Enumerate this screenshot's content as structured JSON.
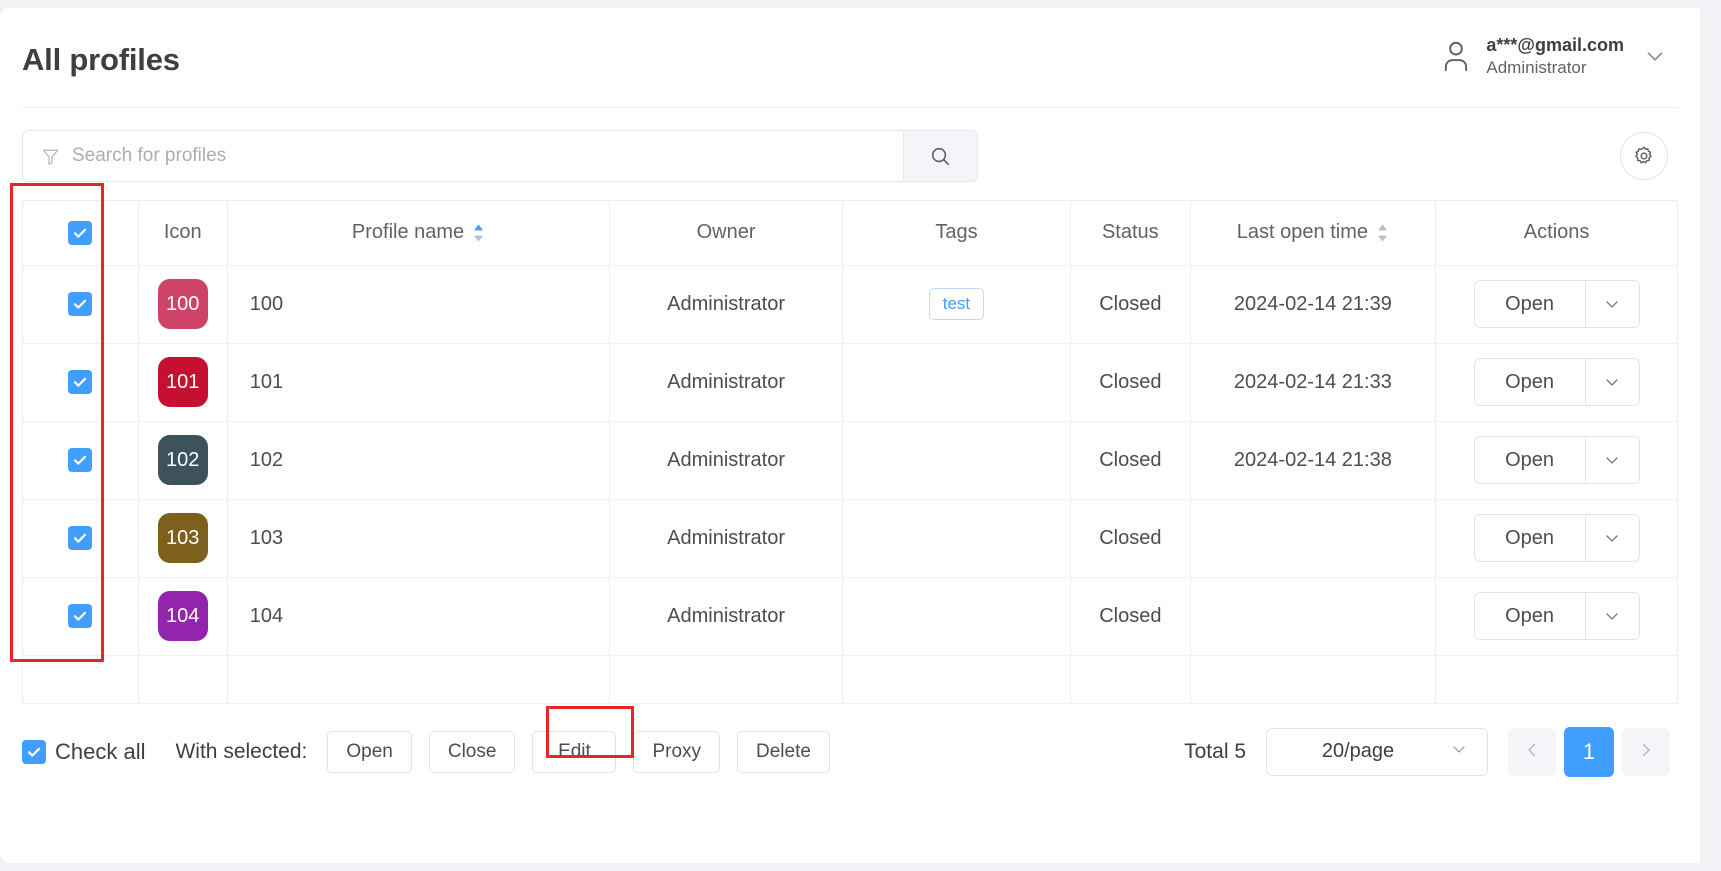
{
  "header": {
    "title": "All profiles",
    "user": {
      "email": "a***@gmail.com",
      "role": "Administrator",
      "avatar_icon": "user-icon",
      "caret_icon": "chevron-down-icon"
    }
  },
  "search": {
    "placeholder": "Search for profiles",
    "value": "",
    "filter_icon": "filter-icon",
    "submit_icon": "search-icon",
    "settings_icon": "gear-icon"
  },
  "table": {
    "columns": [
      {
        "key": "check",
        "label": ""
      },
      {
        "key": "icon",
        "label": "Icon"
      },
      {
        "key": "pname",
        "label": "Profile name",
        "sortable": true
      },
      {
        "key": "owner",
        "label": "Owner"
      },
      {
        "key": "tags",
        "label": "Tags"
      },
      {
        "key": "status",
        "label": "Status"
      },
      {
        "key": "time",
        "label": "Last open time",
        "sortable": true
      },
      {
        "key": "act",
        "label": "Actions"
      }
    ],
    "header_checkbox_checked": true,
    "action_open_label": "Open",
    "rows": [
      {
        "checked": true,
        "badge_text": "100",
        "badge_color": "#cf4368",
        "name": "100",
        "owner": "Administrator",
        "tags": [
          "test"
        ],
        "status": "Closed",
        "last_open_time": "2024-02-14 21:39"
      },
      {
        "checked": true,
        "badge_text": "101",
        "badge_color": "#c6102f",
        "name": "101",
        "owner": "Administrator",
        "tags": [],
        "status": "Closed",
        "last_open_time": "2024-02-14 21:33"
      },
      {
        "checked": true,
        "badge_text": "102",
        "badge_color": "#3d535c",
        "name": "102",
        "owner": "Administrator",
        "tags": [],
        "status": "Closed",
        "last_open_time": "2024-02-14 21:38"
      },
      {
        "checked": true,
        "badge_text": "103",
        "badge_color": "#7c601c",
        "name": "103",
        "owner": "Administrator",
        "tags": [],
        "status": "Closed",
        "last_open_time": ""
      },
      {
        "checked": true,
        "badge_text": "104",
        "badge_color": "#9324ac",
        "name": "104",
        "owner": "Administrator",
        "tags": [],
        "status": "Closed",
        "last_open_time": ""
      }
    ]
  },
  "footer": {
    "check_all_label": "Check all",
    "check_all_checked": true,
    "with_selected_label": "With selected:",
    "bulk_actions": [
      "Open",
      "Close",
      "Edit",
      "Proxy",
      "Delete"
    ],
    "total_label": "Total 5",
    "page_size": "20/page",
    "page_size_caret_icon": "chevron-down-icon",
    "prev_icon": "chevron-left-icon",
    "next_icon": "chevron-right-icon",
    "current_page": "1"
  },
  "annotations": {
    "accent_color": "#e8262a",
    "highlight_checkbox_column": true,
    "highlight_edit_button": true
  },
  "colors": {
    "primary": "#409eff",
    "annotation": "#e8262a"
  }
}
